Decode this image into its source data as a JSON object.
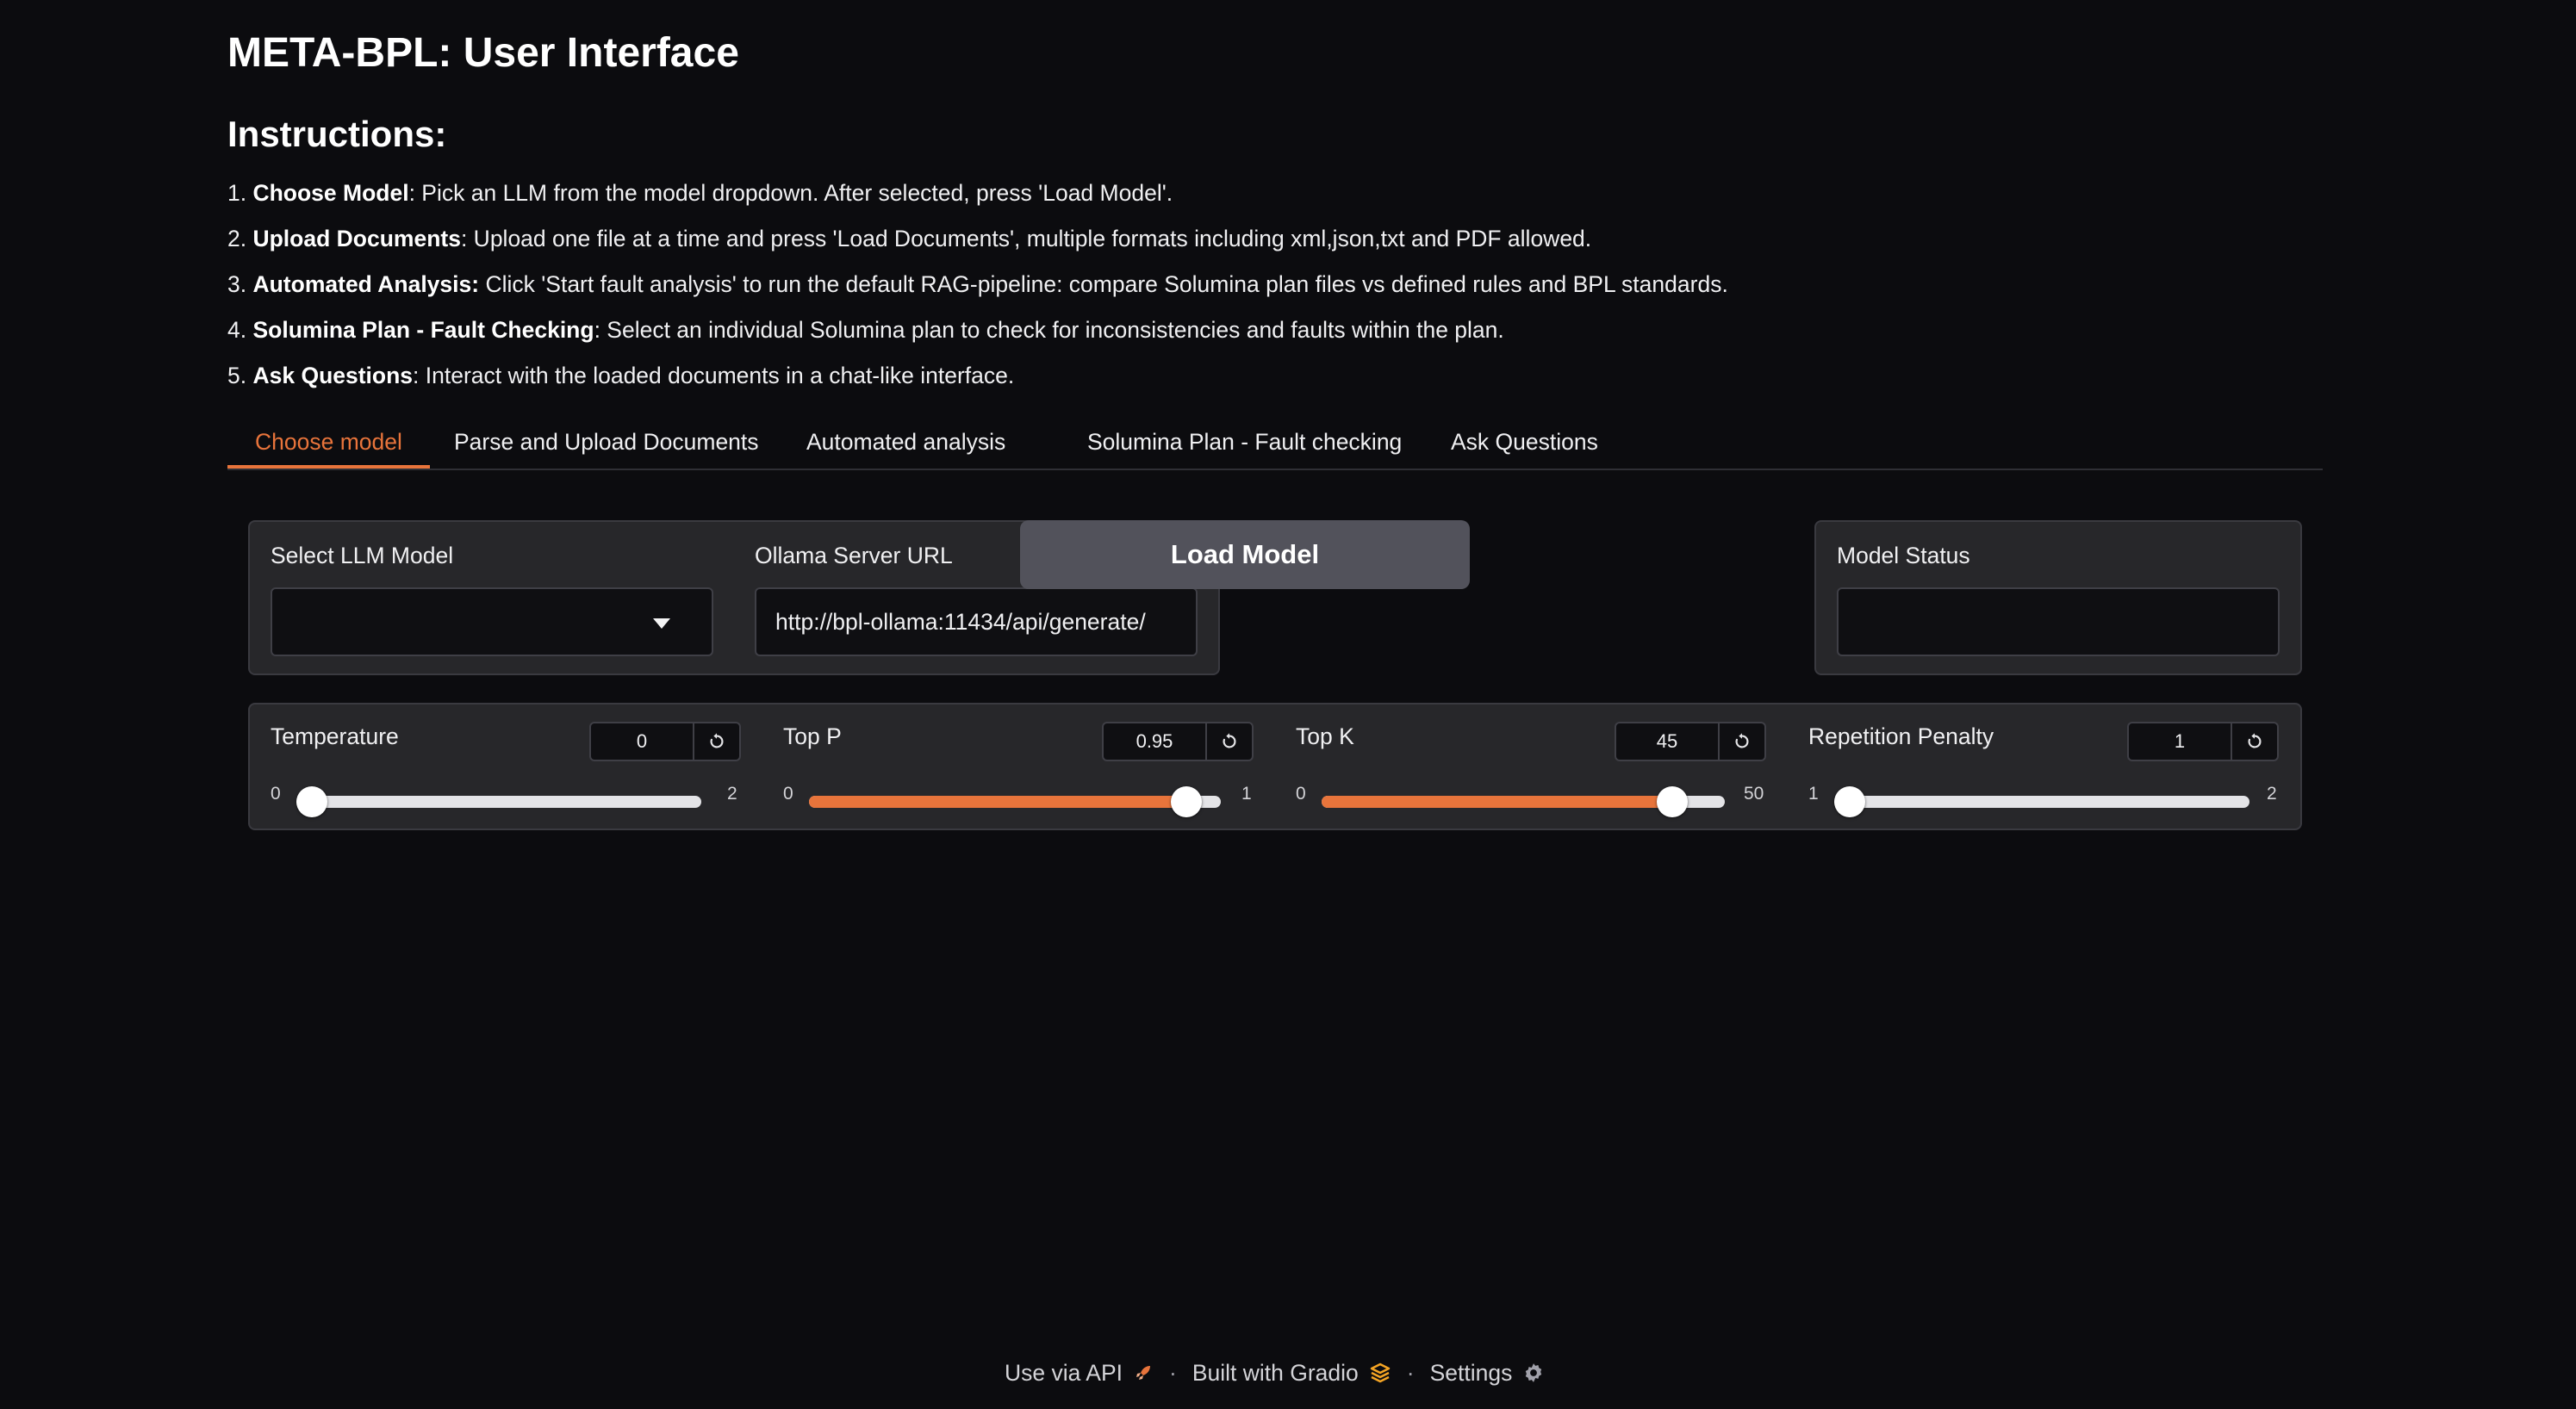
{
  "page": {
    "title": "META-BPL: User Interface",
    "instructions_heading": "Instructions:",
    "steps": [
      {
        "num": "1.",
        "bold": "Choose Model",
        "text": ": Pick an LLM from the model dropdown. After selected, press 'Load Model'."
      },
      {
        "num": "2.",
        "bold": "Upload Documents",
        "text": ": Upload one file at a time and press 'Load Documents', multiple formats including xml,json,txt and PDF allowed."
      },
      {
        "num": "3.",
        "bold": "Automated Analysis:",
        "text": " Click 'Start fault analysis' to run the default RAG-pipeline: compare Solumina plan files vs defined rules and BPL standards."
      },
      {
        "num": "4.",
        "bold": "Solumina Plan - Fault Checking",
        "text": ": Select an individual Solumina plan to check for inconsistencies and faults within the plan."
      },
      {
        "num": "5.",
        "bold": "Ask Questions",
        "text": ": Interact with the loaded documents in a chat-like interface."
      }
    ]
  },
  "tabs": [
    {
      "label": "Choose model",
      "active": true
    },
    {
      "label": "Parse and Upload Documents",
      "active": false
    },
    {
      "label": "Automated analysis",
      "active": false
    },
    {
      "label": "Solumina Plan - Fault checking",
      "active": false
    },
    {
      "label": "Ask Questions",
      "active": false
    }
  ],
  "model_panel": {
    "select_label": "Select LLM Model",
    "select_value": "",
    "url_label": "Ollama Server URL",
    "url_value": "http://bpl-ollama:11434/api/generate/"
  },
  "load_button": {
    "label": "Load Model"
  },
  "status_panel": {
    "label": "Model Status",
    "value": ""
  },
  "sliders": [
    {
      "label": "Temperature",
      "value": "0",
      "min": "0",
      "max": "2",
      "fraction": 0.0,
      "show_fill": false
    },
    {
      "label": "Top P",
      "value": "0.95",
      "min": "0",
      "max": "1",
      "fraction": 0.95,
      "show_fill": true
    },
    {
      "label": "Top K",
      "value": "45",
      "min": "0",
      "max": "50",
      "fraction": 0.9,
      "show_fill": true
    },
    {
      "label": "Repetition Penalty",
      "value": "1",
      "min": "1",
      "max": "2",
      "fraction": 0.0,
      "show_fill": false
    }
  ],
  "footer": {
    "api": "Use via API",
    "built": "Built with Gradio",
    "settings": "Settings",
    "sep": "·"
  },
  "colors": {
    "accent": "#e8743b",
    "background": "#0c0c0f",
    "panel": "#27272a"
  }
}
